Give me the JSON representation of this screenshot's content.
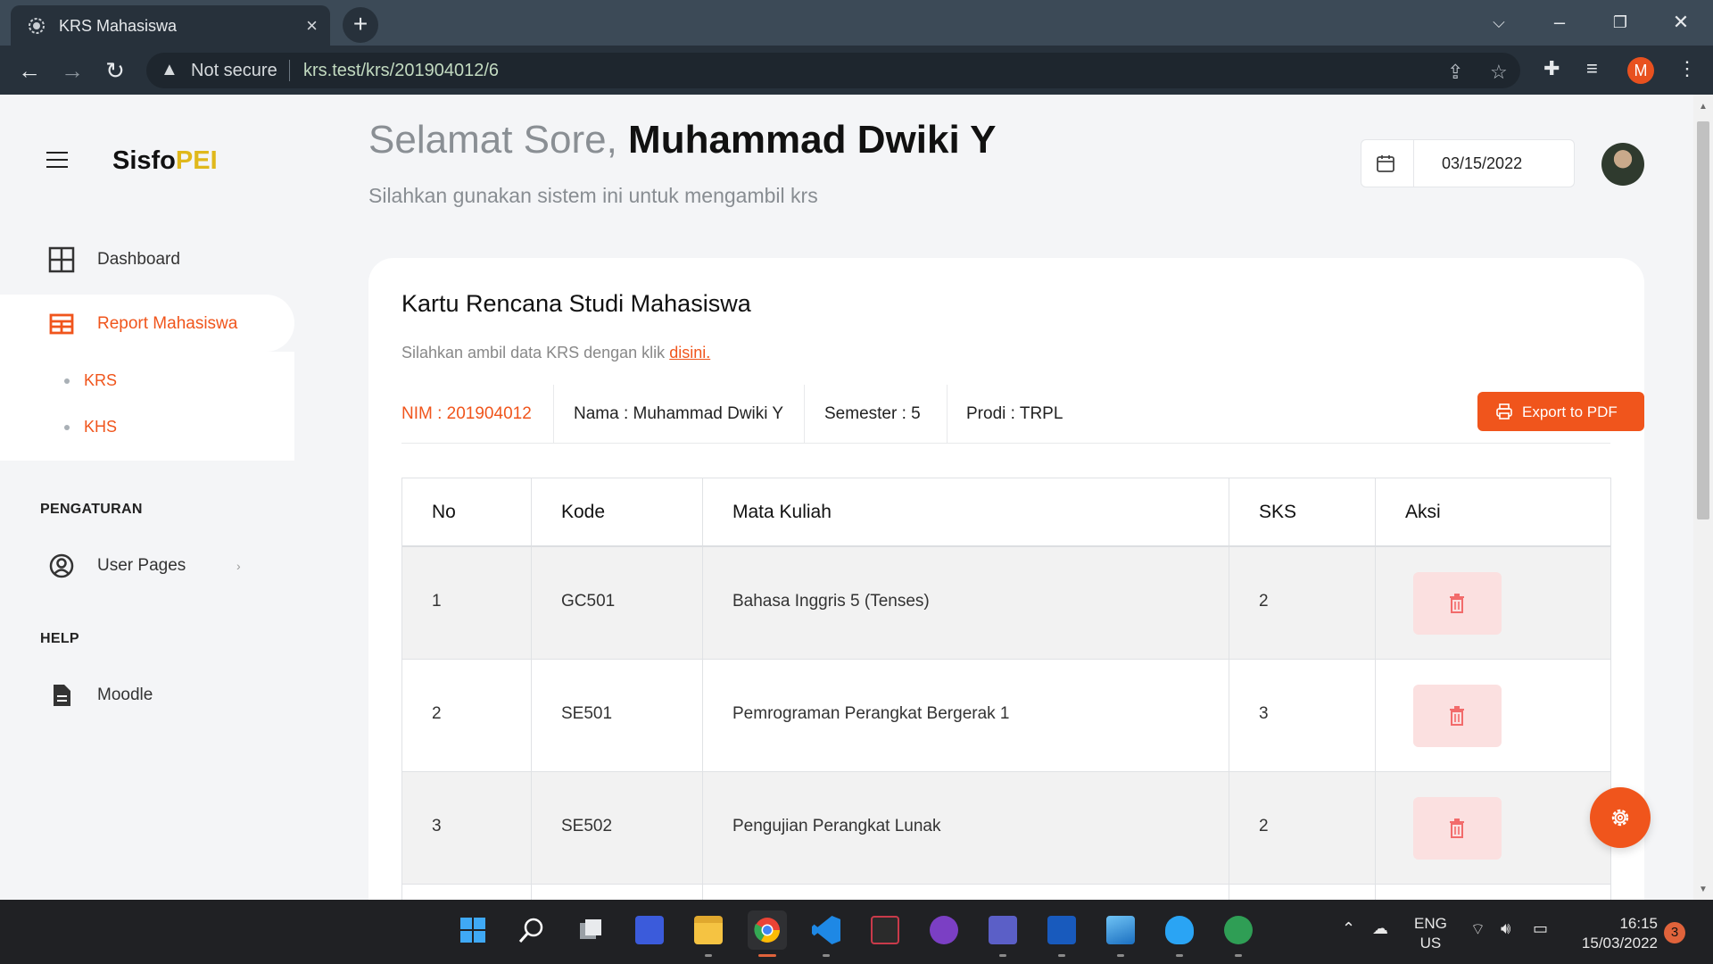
{
  "browser": {
    "tab_title": "KRS Mahasiswa",
    "new_tab_label": "+",
    "security_label": "Not secure",
    "url_host": "krs.test",
    "url_path": "/krs/201904012/6",
    "profile_initial": "M"
  },
  "sidebar": {
    "logo_main": "Sisfo",
    "logo_accent": "PEI",
    "items": [
      {
        "label": "Dashboard",
        "icon": "grid-icon"
      },
      {
        "label": "Report Mahasiswa",
        "icon": "table-icon"
      }
    ],
    "subitems": [
      {
        "label": "KRS"
      },
      {
        "label": "KHS"
      }
    ],
    "section_settings": "PENGATURAN",
    "settings_items": [
      {
        "label": "User Pages",
        "icon": "user-circle-icon"
      }
    ],
    "section_help": "HELP",
    "help_items": [
      {
        "label": "Moodle",
        "icon": "document-icon"
      }
    ]
  },
  "header": {
    "greeting": "Selamat Sore,",
    "user_name": "Muhammad Dwiki Y",
    "subtitle": "Silahkan gunakan sistem ini untuk mengambil krs",
    "date": "03/15/2022"
  },
  "card": {
    "title": "Kartu Rencana Studi Mahasiswa",
    "instruction": "Silahkan ambil data KRS dengan klik",
    "instruction_link": "disini.",
    "nim": "NIM : 201904012",
    "nama": "Nama : Muhammad Dwiki Y",
    "semester": "Semester : 5",
    "prodi": "Prodi : TRPL",
    "export_label": "Export to PDF"
  },
  "table": {
    "headers": [
      "No",
      "Kode",
      "Mata Kuliah",
      "SKS",
      "Aksi"
    ],
    "rows": [
      {
        "no": "1",
        "kode": "GC501",
        "mata_kuliah": "Bahasa Inggris 5 (Tenses)",
        "sks": "2"
      },
      {
        "no": "2",
        "kode": "SE501",
        "mata_kuliah": "Pemrograman Perangkat Bergerak 1",
        "sks": "3"
      },
      {
        "no": "3",
        "kode": "SE502",
        "mata_kuliah": "Pengujian Perangkat Lunak",
        "sks": "2"
      }
    ]
  },
  "taskbar": {
    "lang_top": "ENG",
    "lang_bottom": "US",
    "time": "16:15",
    "date": "15/03/2022",
    "notification_count": "3"
  },
  "colors": {
    "accent": "#f0551c",
    "logo_accent": "#e0b81b",
    "delete_bg": "#fbe0e0",
    "delete_icon": "#f26b6b"
  }
}
